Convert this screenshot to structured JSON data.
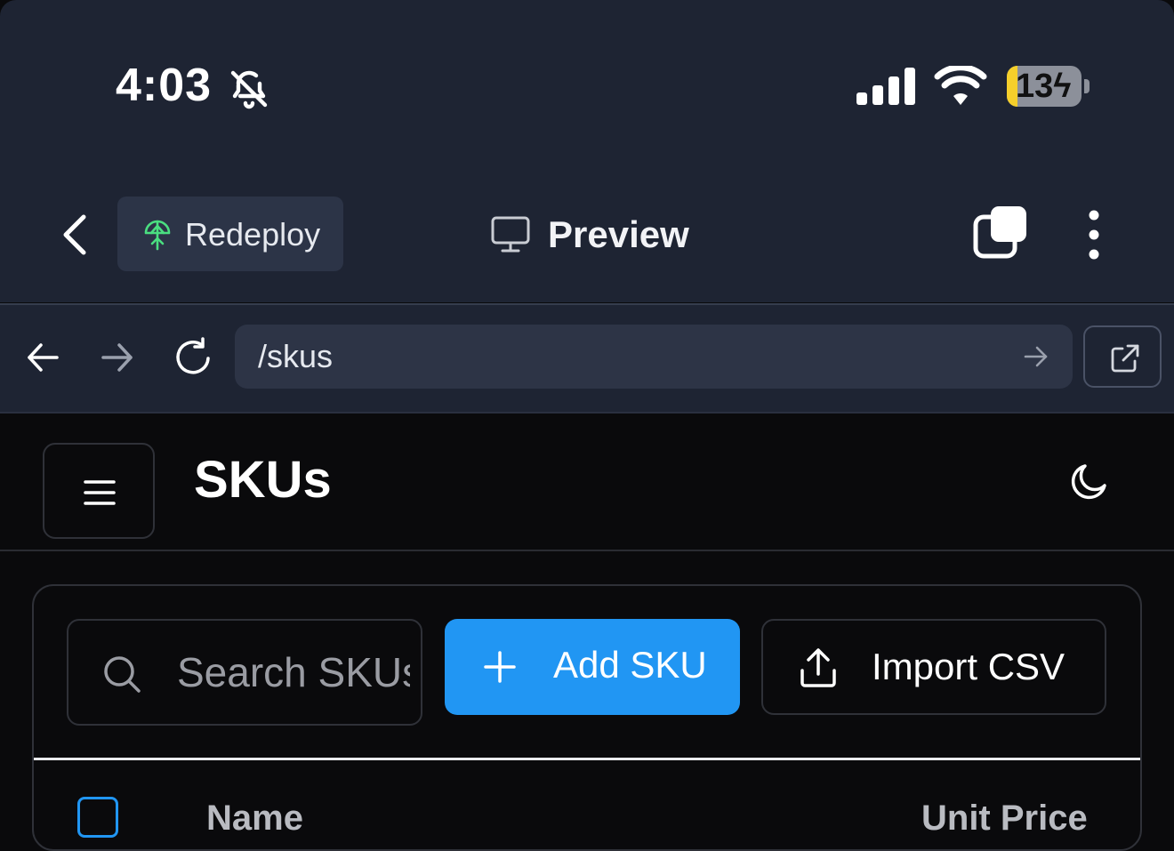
{
  "status_bar": {
    "time": "4:03",
    "battery_percent": "13",
    "icons": [
      "bell-slash-icon",
      "cellular-signal-icon",
      "wifi-icon",
      "battery-charging-icon"
    ]
  },
  "browser": {
    "redeploy_label": "Redeploy",
    "preview_label": "Preview",
    "url": "/skus"
  },
  "app": {
    "title": "SKUs",
    "search_placeholder": "Search SKUs",
    "add_label": "Add SKU",
    "import_label": "Import CSV",
    "table": {
      "columns": [
        "Name",
        "Unit Price"
      ]
    }
  },
  "colors": {
    "chrome_bg": "#1e2433",
    "app_bg": "#0a0a0c",
    "accent": "#2196f3",
    "redeploy_icon": "#4ade80",
    "battery_low": "#f5cf2b"
  }
}
